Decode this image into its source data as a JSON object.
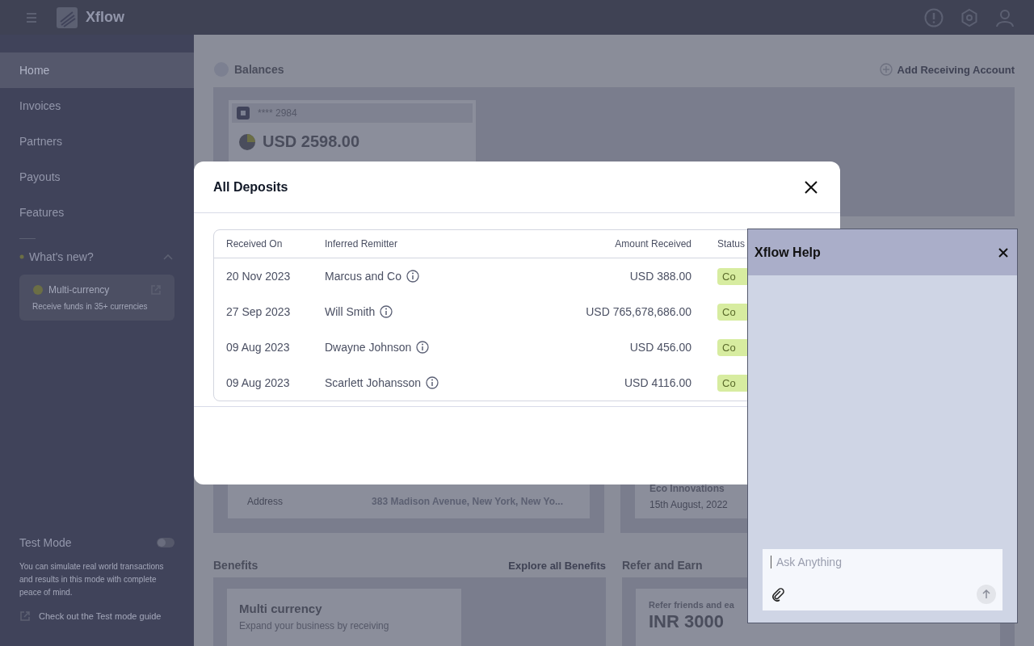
{
  "app": {
    "logo": "Xflow"
  },
  "sidebar": {
    "items": [
      {
        "label": "Home",
        "selected": true
      },
      {
        "label": "Invoices",
        "selected": false
      },
      {
        "label": "Partners",
        "selected": false
      },
      {
        "label": "Payouts",
        "selected": false
      },
      {
        "label": "Features",
        "selected": false
      }
    ],
    "whats_new": {
      "label": "What's new?",
      "expanded": true,
      "card": {
        "title": "Multi-currency",
        "text": "Receive funds in 35+ currencies"
      }
    },
    "test_mode": {
      "label": "Test Mode",
      "on": false,
      "description": "You can simulate real world transactions and results in this mode with complete peace of mind.",
      "link": "Check out the Test mode guide"
    }
  },
  "main": {
    "balances": {
      "title": "Balances",
      "action": "Add Receiving Account",
      "account": {
        "number": "**** 2984",
        "amount": "USD 2598.00"
      }
    },
    "details": {
      "label": "Address",
      "value": "383 Madison Avenue, New York, New Yo..."
    },
    "partner": {
      "name": "Eco Innovations",
      "date": "15th August, 2022"
    },
    "benefits": {
      "title": "Benefits",
      "link": "Explore all Benefits",
      "card_title": "Multi currency",
      "card_text": "Expand your business by receiving"
    },
    "refer": {
      "title": "Refer and Earn",
      "text": "Refer friends and ea",
      "amount": "INR 3000"
    }
  },
  "modal": {
    "title": "All Deposits",
    "columns": [
      "Received On",
      "Inferred Remitter",
      "Amount Received",
      "Status"
    ],
    "rows": [
      {
        "date": "20 Nov 2023",
        "remitter": "Marcus and Co",
        "amount": "USD 388.00",
        "status": "Co"
      },
      {
        "date": "27 Sep 2023",
        "remitter": "Will Smith",
        "amount": "USD 765,678,686.00",
        "status": "Co"
      },
      {
        "date": "09 Aug 2023",
        "remitter": "Dwayne Johnson",
        "amount": "USD 456.00",
        "status": "Co"
      },
      {
        "date": "09 Aug 2023",
        "remitter": "Scarlett Johansson",
        "amount": "USD 4116.00",
        "status": "Co"
      }
    ]
  },
  "help": {
    "title": "Xflow Help",
    "input": {
      "placeholder": "Ask Anything"
    }
  }
}
